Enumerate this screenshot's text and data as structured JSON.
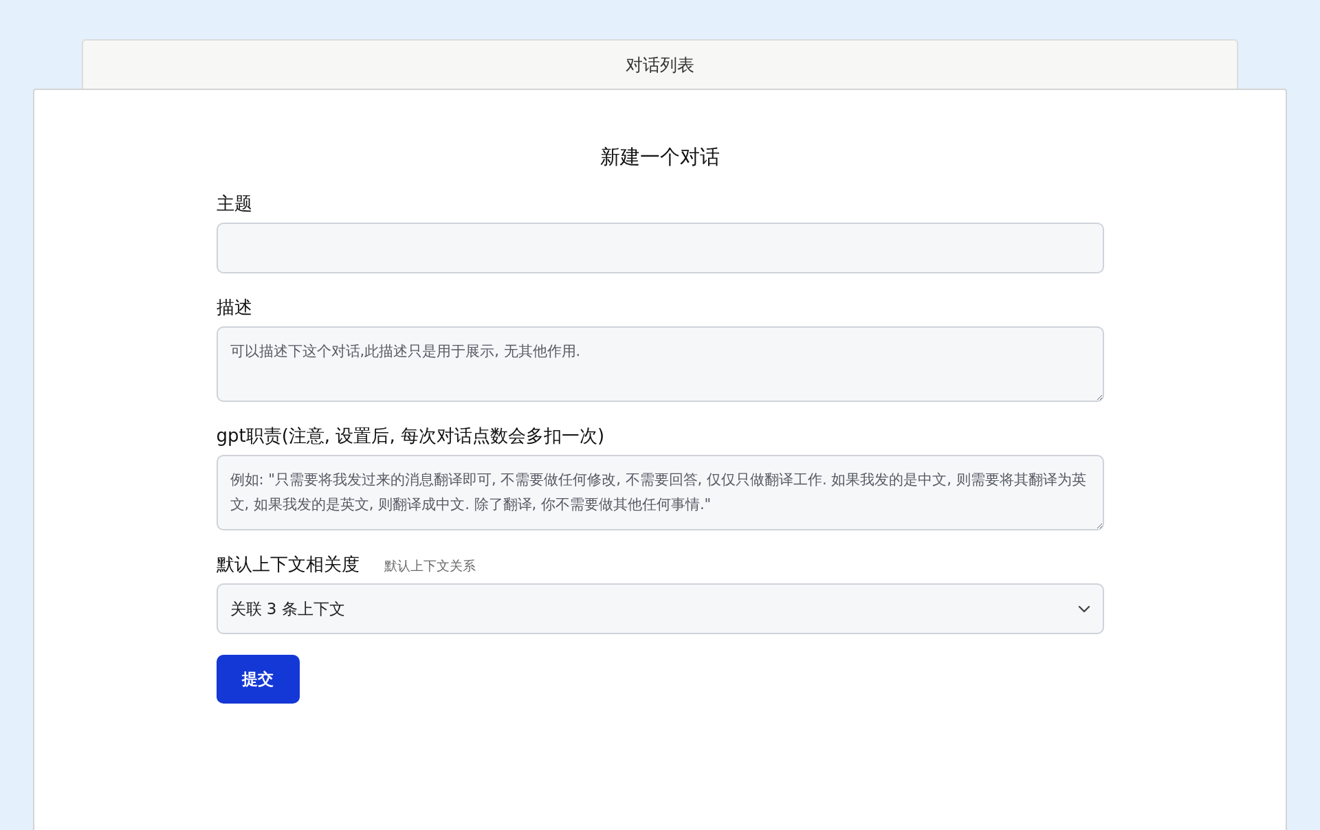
{
  "tab": {
    "label": "对话列表"
  },
  "form": {
    "title": "新建一个对话",
    "fields": [
      {
        "kind": "input",
        "label": "主题"
      },
      {
        "kind": "textarea",
        "label": "描述",
        "placeholder": "可以描述下这个对话,此描述只是用于展示, 无其他作用."
      },
      {
        "kind": "textarea",
        "label": "gpt职责(注意, 设置后, 每次对话点数会多扣一次)",
        "placeholder": "例如: \"只需要将我发过来的消息翻译即可, 不需要做任何修改, 不需要回答, 仅仅只做翻译工作. 如果我发的是中文, 则需要将其翻译为英文, 如果我发的是英文, 则翻译成中文. 除了翻译, 你不需要做其他任何事情.\""
      },
      {
        "kind": "select",
        "label": "默认上下文相关度",
        "hint": "默认上下文关系",
        "value": "关联 3 条上下文"
      }
    ],
    "submit": "提交"
  }
}
